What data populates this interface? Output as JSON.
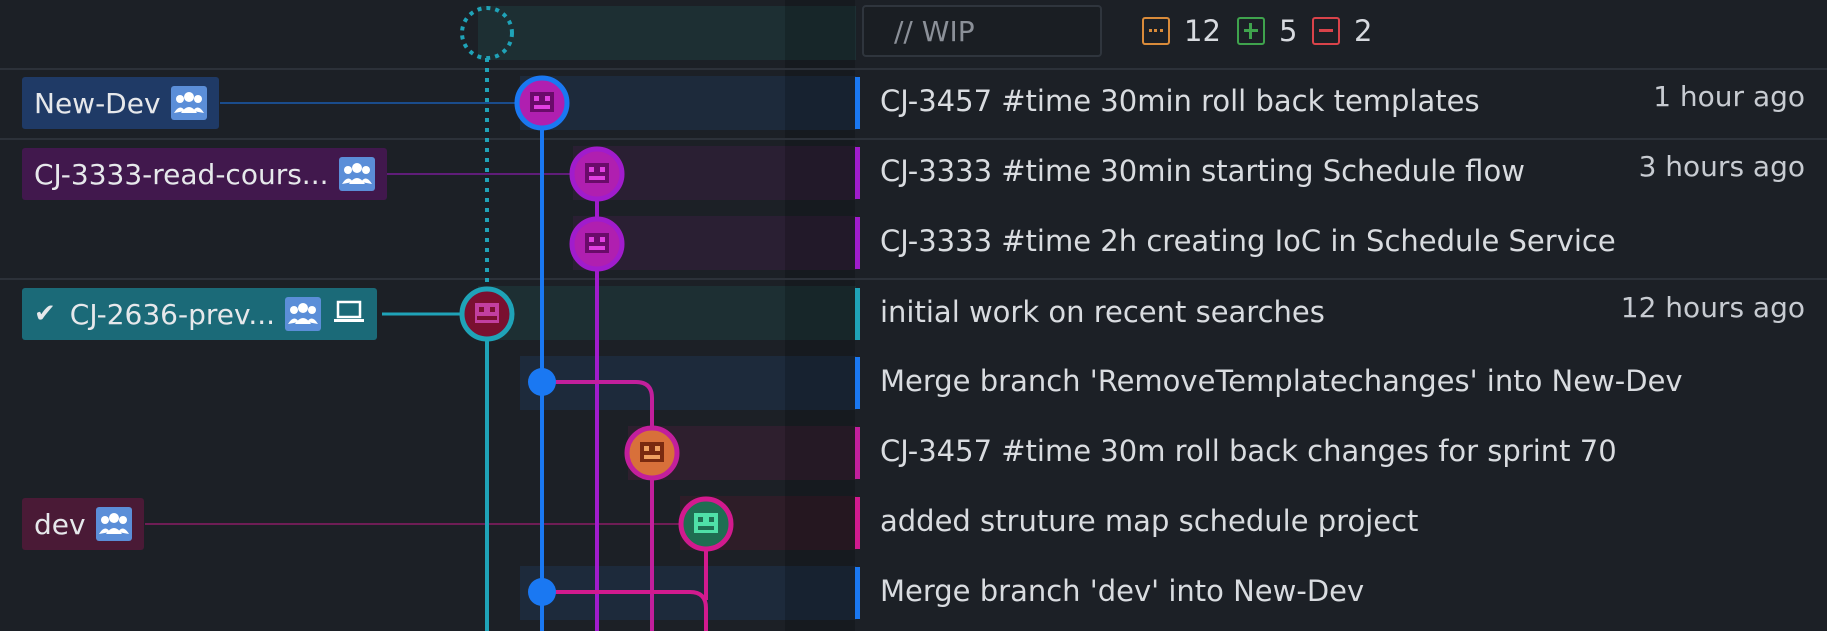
{
  "wip": {
    "placeholder": "// WIP"
  },
  "stats": {
    "modified": "12",
    "added": "5",
    "removed": "2"
  },
  "colors": {
    "blue": "#1a78f2",
    "purple": "#a11ccc",
    "teal": "#1fa3b8",
    "magenta": "#d21a8e",
    "pink": "#c21f9c"
  },
  "refs": {
    "new_dev": {
      "label": "New-Dev",
      "icon": "team-icon"
    },
    "cj3333": {
      "label": "CJ-3333-read-cours...",
      "icon": "team-icon"
    },
    "cj2636": {
      "label": "CJ-2636-prev...",
      "icons": [
        "check-icon",
        "team-icon",
        "laptop-icon"
      ]
    },
    "dev": {
      "label": "dev",
      "icon": "team-icon"
    }
  },
  "commits": [
    {
      "message": "CJ-3457 #time 30min roll back templates",
      "time": "1 hour ago"
    },
    {
      "message": "CJ-3333 #time 30min starting Schedule flow",
      "time": "3 hours ago"
    },
    {
      "message": "CJ-3333 #time 2h creating IoC in Schedule Service",
      "time": ""
    },
    {
      "message": "initial work on recent searches",
      "time": "12 hours ago"
    },
    {
      "message": "Merge branch 'RemoveTemplatechanges' into New-Dev",
      "time": ""
    },
    {
      "message": "CJ-3457 #time 30m roll back changes for sprint 70",
      "time": ""
    },
    {
      "message": "added struture map schedule project",
      "time": ""
    },
    {
      "message": "Merge branch 'dev' into New-Dev",
      "time": ""
    }
  ]
}
